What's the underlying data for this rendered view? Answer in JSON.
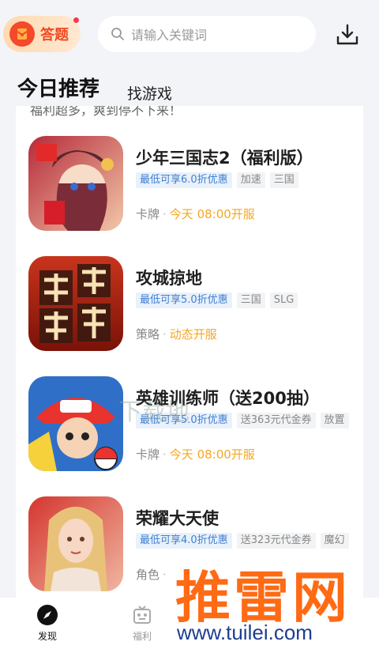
{
  "header": {
    "quiz_label": "答题",
    "search_placeholder": "请输入关键词"
  },
  "tabs": [
    {
      "label": "今日推荐"
    },
    {
      "label": "找游戏"
    }
  ],
  "intro_text": "福利超多，爽到停不下来！",
  "games": [
    {
      "title": "少年三国志2（福利版）",
      "tags": [
        {
          "text": "最低可享6.0折优惠"
        },
        {
          "text": "加速"
        },
        {
          "text": "三国"
        }
      ],
      "category": "卡牌",
      "separator": "·",
      "time": "今天 08:00开服",
      "icon": "shaonian-sanguozhi-icon"
    },
    {
      "title": "攻城掠地",
      "tags": [
        {
          "text": "最低可享5.0折优惠"
        },
        {
          "text": "三国"
        },
        {
          "text": "SLG"
        }
      ],
      "category": "策略",
      "separator": "·",
      "time": "动态开服",
      "icon": "gongcheng-luedi-icon"
    },
    {
      "title": "英雄训练师（送200抽）",
      "tags": [
        {
          "text": "最低可享5.0折优惠"
        },
        {
          "text": "送363元代金券"
        },
        {
          "text": "放置"
        }
      ],
      "category": "卡牌",
      "separator": "·",
      "time": "今天 08:00开服",
      "icon": "yingxiong-xunlianshi-icon"
    },
    {
      "title": "荣耀大天使",
      "tags": [
        {
          "text": "最低可享4.0折优惠"
        },
        {
          "text": "送323元代金券"
        },
        {
          "text": "魔幻"
        }
      ],
      "category": "角色",
      "separator": "·",
      "time": "",
      "icon": "rongyao-datianshi-icon"
    }
  ],
  "bottom_nav": [
    {
      "label": "发现",
      "icon": "compass-icon",
      "active": true
    },
    {
      "label": "福利",
      "icon": "gift-robot-icon",
      "active": false
    }
  ],
  "watermarks": {
    "brand": "推雷网",
    "url": "www.tuilei.com",
    "faint": "下载地"
  },
  "colors": {
    "accent_orange": "#f5a623",
    "discount_blue": "#3f7fd2",
    "quiz_red": "#f04a23"
  }
}
